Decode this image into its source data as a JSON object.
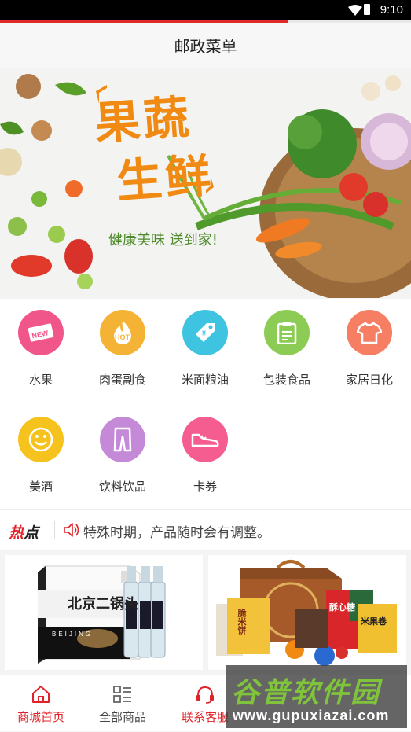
{
  "status_bar": {
    "time": "9:10"
  },
  "loading": {
    "progress": 0.7
  },
  "header": {
    "title": "邮政菜单"
  },
  "banner": {
    "headline_line1": "果蔬",
    "headline_line2": "生鲜",
    "slogan": "健康美味 送到家!"
  },
  "categories": [
    {
      "label": "水果",
      "icon": "new-tag-icon",
      "color": "#f1568a"
    },
    {
      "label": "肉蛋副食",
      "icon": "hot-tag-icon",
      "color": "#f5b335"
    },
    {
      "label": "米面粮油",
      "icon": "price-tag-icon",
      "color": "#3ec4e0"
    },
    {
      "label": "包装食品",
      "icon": "clipboard-icon",
      "color": "#8ccc55"
    },
    {
      "label": "家居日化",
      "icon": "shirt-icon",
      "color": "#f57e63"
    },
    {
      "label": "美酒",
      "icon": "smile-icon",
      "color": "#f6c21e"
    },
    {
      "label": "饮料饮品",
      "icon": "trousers-icon",
      "color": "#c48ad8"
    },
    {
      "label": "卡券",
      "icon": "sneaker-icon",
      "color": "#f55c8f"
    }
  ],
  "hot": {
    "title_part1": "热",
    "title_part2": "点",
    "notice": "特殊时期，产品随时会有调整。"
  },
  "products": [
    {
      "box_text": "北京二锅头",
      "box_subtext": "BEIJING"
    },
    {
      "label_1": "脆米饼",
      "label_2": "酥心糖",
      "label_3": "米果卷"
    }
  ],
  "tabbar": {
    "tabs": [
      {
        "label": "商城首页",
        "icon": "home-icon",
        "active": true
      },
      {
        "label": "全部商品",
        "icon": "grid-list-icon",
        "active": false
      },
      {
        "label": "联系客服",
        "icon": "headset-icon",
        "active": false
      }
    ]
  },
  "watermark": {
    "line1": "谷普软件园",
    "line2": "www.gupuxiazai.com"
  },
  "colors": {
    "accent": "#e0232a",
    "banner_text": "#f08a12",
    "slogan": "#4c8a2a"
  }
}
